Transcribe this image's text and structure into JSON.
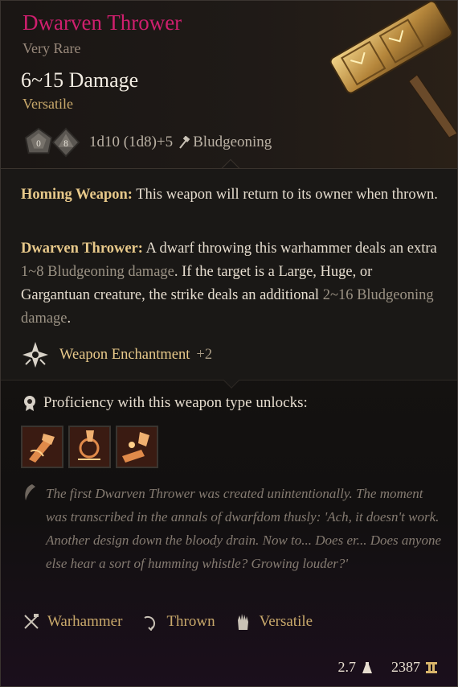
{
  "item": {
    "name": "Dwarven Thrower",
    "rarity": "Very Rare",
    "damage": "6~15 Damage",
    "property": "Versatile",
    "dice_formula": "1d10 (1d8)+5",
    "damage_type": "Bludgeoning",
    "dice": [
      {
        "label": "0",
        "icon": "d10-die-icon"
      },
      {
        "label": "8",
        "icon": "d8-die-icon"
      }
    ]
  },
  "effects": {
    "homing": {
      "name": "Homing Weapon:",
      "text": " This weapon will return to its owner when thrown."
    },
    "thrower": {
      "name": "Dwarven Thrower:",
      "text_a": " A dwarf throwing this warhammer deals an extra ",
      "dim_a": "1~8 Bludgeoning damage",
      "text_b": ". If the target is a Large, Huge, or Gargantuan creature, the strike deals an additional ",
      "dim_b": "2~16 Bludgeoning damage",
      "text_c": "."
    },
    "enchant_label": "Weapon Enchantment",
    "enchant_value": "+2"
  },
  "proficiency": {
    "label": "Proficiency with this weapon type unlocks:",
    "actions": [
      {
        "icon": "cleave-action-icon"
      },
      {
        "icon": "concussive-smash-icon"
      },
      {
        "icon": "topple-action-icon"
      }
    ]
  },
  "lore": "The first Dwarven Thrower was created unintentionally. The moment was transcribed in the annals of dwarfdom thusly: 'Ach, it doesn't work. Another design down the bloody drain. Now to... Does er... Does anyone else hear a sort of humming whistle? Growing louder?'",
  "tags": [
    {
      "label": "Warhammer",
      "icon": "warhammer-icon"
    },
    {
      "label": "Thrown",
      "icon": "thrown-icon"
    },
    {
      "label": "Versatile",
      "icon": "hand-icon"
    }
  ],
  "footer": {
    "weight": "2.7",
    "value": "2387"
  },
  "colors": {
    "title": "#cf1f6e",
    "gold": "#e8c98a",
    "muted": "#9b9284"
  }
}
